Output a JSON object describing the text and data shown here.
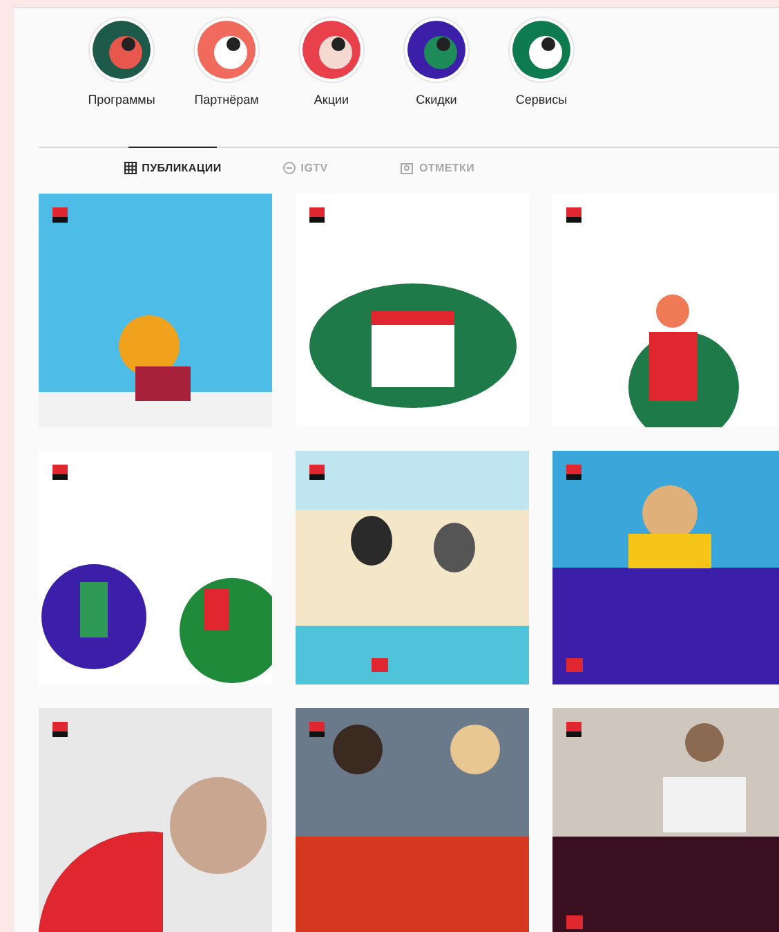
{
  "highlights": [
    {
      "label": "Программы"
    },
    {
      "label": "Партнёрам"
    },
    {
      "label": "Акции"
    },
    {
      "label": "Скидки"
    },
    {
      "label": "Сервисы"
    }
  ],
  "tabs": [
    {
      "label": "ПУБЛИКАЦИИ",
      "kind": "grid",
      "selected": true
    },
    {
      "label": "IGTV",
      "kind": "tv",
      "selected": false
    },
    {
      "label": "ОТМЕТКИ",
      "kind": "tag",
      "selected": false
    }
  ],
  "posts": [
    {
      "kind": "image"
    },
    {
      "kind": "image"
    },
    {
      "kind": "image"
    },
    {
      "kind": "image"
    },
    {
      "kind": "image"
    },
    {
      "kind": "image"
    },
    {
      "kind": "image"
    },
    {
      "kind": "image"
    },
    {
      "kind": "image"
    }
  ]
}
